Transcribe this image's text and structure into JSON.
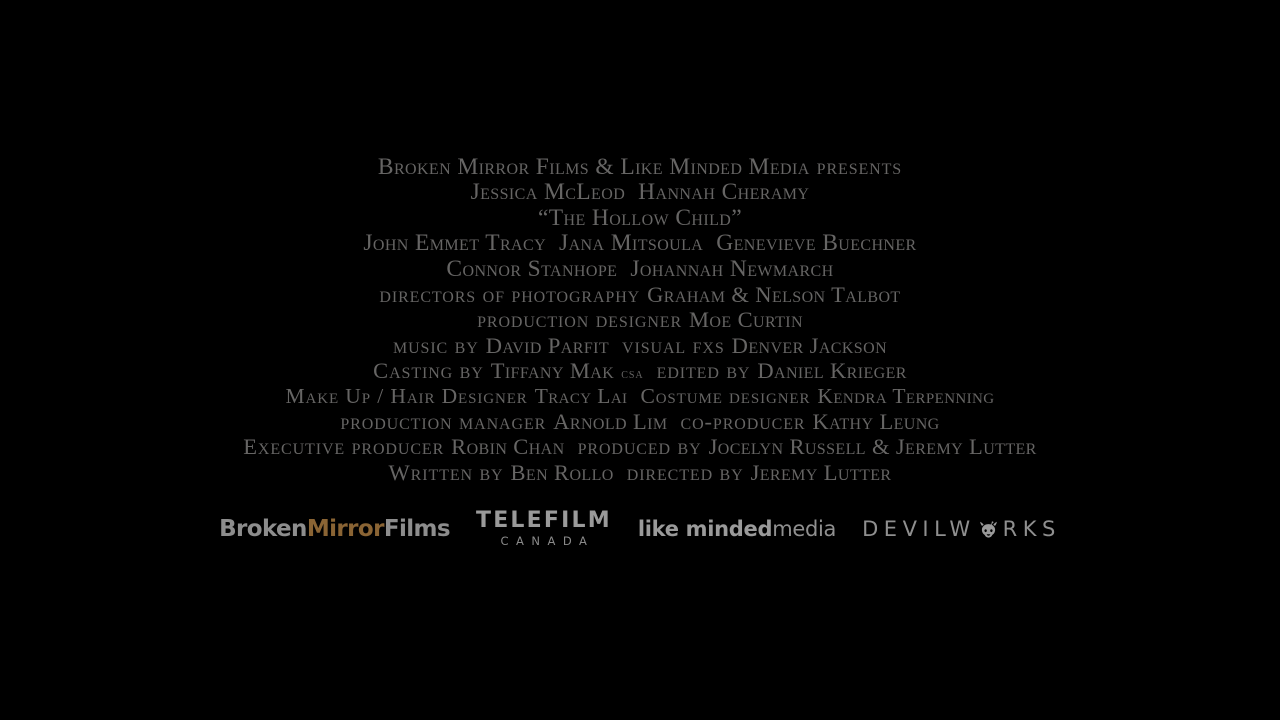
{
  "screen": {
    "background_color": "#000000",
    "text_color": "#666564"
  },
  "credits": [
    {
      "id": "presents",
      "size_class": "line-presents",
      "segments": [
        {
          "type": "name",
          "text": "Broken Mirror Films & Like Minded Media"
        },
        {
          "type": "gap-sm"
        },
        {
          "type": "role",
          "text": "presents"
        }
      ]
    },
    {
      "id": "leads",
      "size_class": "line-leads",
      "segments": [
        {
          "type": "name",
          "text": "Jessica McLeod"
        },
        {
          "type": "gap"
        },
        {
          "type": "name",
          "text": "Hannah Cheramy"
        }
      ]
    },
    {
      "id": "film-title",
      "size_class": "line-title",
      "segments": [
        {
          "type": "name",
          "text": "“The Hollow Child”"
        }
      ]
    },
    {
      "id": "cast-row-1",
      "size_class": "line-cast",
      "segments": [
        {
          "type": "name",
          "text": "John Emmet Tracy"
        },
        {
          "type": "gap"
        },
        {
          "type": "name",
          "text": "Jana Mitsoula"
        },
        {
          "type": "gap"
        },
        {
          "type": "name",
          "text": "Genevieve Buechner"
        }
      ]
    },
    {
      "id": "cast-row-2",
      "size_class": "line-cast",
      "segments": [
        {
          "type": "name",
          "text": "Connor Stanhope"
        },
        {
          "type": "gap"
        },
        {
          "type": "name",
          "text": "Johannah Newmarch"
        }
      ]
    },
    {
      "id": "directors-of-photography",
      "size_class": "line-crew",
      "segments": [
        {
          "type": "role",
          "text": "directors of photography"
        },
        {
          "type": "gap-sm"
        },
        {
          "type": "name",
          "text": "Graham & Nelson Talbot"
        }
      ]
    },
    {
      "id": "production-designer",
      "size_class": "line-crew",
      "segments": [
        {
          "type": "role",
          "text": "production designer"
        },
        {
          "type": "gap-sm"
        },
        {
          "type": "name",
          "text": "Moe Curtin"
        }
      ]
    },
    {
      "id": "music-and-vfx",
      "size_class": "line-crew",
      "segments": [
        {
          "type": "role",
          "text": "music by"
        },
        {
          "type": "gap-sm"
        },
        {
          "type": "name",
          "text": "David Parfit"
        },
        {
          "type": "gap"
        },
        {
          "type": "role",
          "text": "visual fxs"
        },
        {
          "type": "gap-sm"
        },
        {
          "type": "name",
          "text": "Denver Jackson"
        }
      ]
    },
    {
      "id": "casting-and-editor",
      "size_class": "line-crew",
      "segments": [
        {
          "type": "role",
          "text": "Casting by"
        },
        {
          "type": "gap-sm"
        },
        {
          "type": "name",
          "text": "Tiffany Mak"
        },
        {
          "type": "gap-sm"
        },
        {
          "type": "suffix",
          "text": "csa"
        },
        {
          "type": "gap"
        },
        {
          "type": "role",
          "text": "edited by"
        },
        {
          "type": "gap-sm"
        },
        {
          "type": "name",
          "text": "Daniel Krieger"
        }
      ]
    },
    {
      "id": "makeup-and-costume",
      "size_class": "line-crew-sm",
      "segments": [
        {
          "type": "role",
          "text": "Make Up / Hair Designer"
        },
        {
          "type": "gap-sm"
        },
        {
          "type": "name",
          "text": "Tracy Lai"
        },
        {
          "type": "gap"
        },
        {
          "type": "role",
          "text": "Costume designer"
        },
        {
          "type": "gap-sm"
        },
        {
          "type": "name",
          "text": "Kendra Terpenning"
        }
      ]
    },
    {
      "id": "production-manager-and-coproducer",
      "size_class": "line-crew",
      "segments": [
        {
          "type": "role",
          "text": "production manager"
        },
        {
          "type": "gap-sm"
        },
        {
          "type": "name",
          "text": "Arnold Lim"
        },
        {
          "type": "gap"
        },
        {
          "type": "role",
          "text": "co-producer"
        },
        {
          "type": "gap-sm"
        },
        {
          "type": "name",
          "text": "Kathy Leung"
        }
      ]
    },
    {
      "id": "executive-producer-and-producers",
      "size_class": "line-crew",
      "segments": [
        {
          "type": "role",
          "text": "Executive producer"
        },
        {
          "type": "gap-sm"
        },
        {
          "type": "name",
          "text": "Robin Chan"
        },
        {
          "type": "gap"
        },
        {
          "type": "role",
          "text": "produced by"
        },
        {
          "type": "gap-sm"
        },
        {
          "type": "name",
          "text": "Jocelyn Russell & Jeremy Lutter"
        }
      ]
    },
    {
      "id": "writer-and-director",
      "size_class": "line-crew",
      "segments": [
        {
          "type": "role",
          "text": "Written by"
        },
        {
          "type": "gap-sm"
        },
        {
          "type": "name",
          "text": "Ben Rollo"
        },
        {
          "type": "gap"
        },
        {
          "type": "role",
          "text": "directed by"
        },
        {
          "type": "gap-sm"
        },
        {
          "type": "name",
          "text": "Jeremy Lutter"
        }
      ]
    }
  ],
  "logos": {
    "broken_mirror_films": {
      "name": "Broken Mirror Films",
      "part_1": "Broken",
      "part_2": "Mirror",
      "part_3": "Films",
      "accent_color": "#8a6434",
      "base_color": "#8d8d8d"
    },
    "telefilm_canada": {
      "name": "Telefilm Canada",
      "top": "TELEFILM",
      "bottom": "CANADA",
      "color": "#9a9a9a"
    },
    "like_minded_media": {
      "name": "like minded media",
      "part_bold": "like minded",
      "part_light": "media",
      "color": "#9a9a9a"
    },
    "devilworks": {
      "name": "Devilworks",
      "part_1": "DEVILW",
      "part_2": "RKS",
      "glyph": "devil-head-icon",
      "color": "#8f8f8f"
    }
  }
}
